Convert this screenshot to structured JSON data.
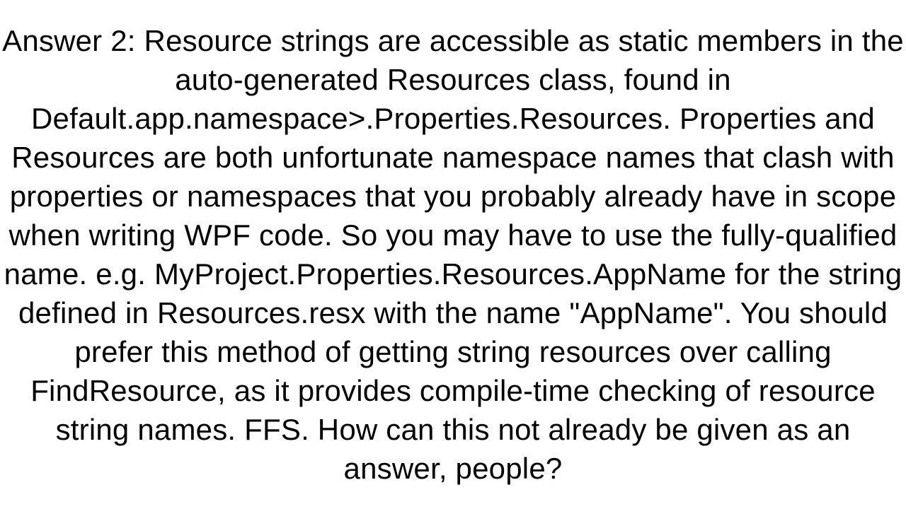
{
  "answer": {
    "label": "Answer 2:",
    "body": "Resource strings are accessible as static members in the auto-generated Resources class, found in Default.app.namespace>.Properties.Resources. Properties and Resources are both unfortunate namespace names that clash with properties or namespaces that you probably already have in scope when writing WPF code. So you may have to use the fully-qualified name. e.g. MyProject.Properties.Resources.AppName  for the string defined in Resources.resx with the name \"AppName\". You should prefer this method of getting string resources over calling FindResource, as it provides compile-time checking of resource string names. FFS. How can this not already be given as an answer, people?"
  }
}
